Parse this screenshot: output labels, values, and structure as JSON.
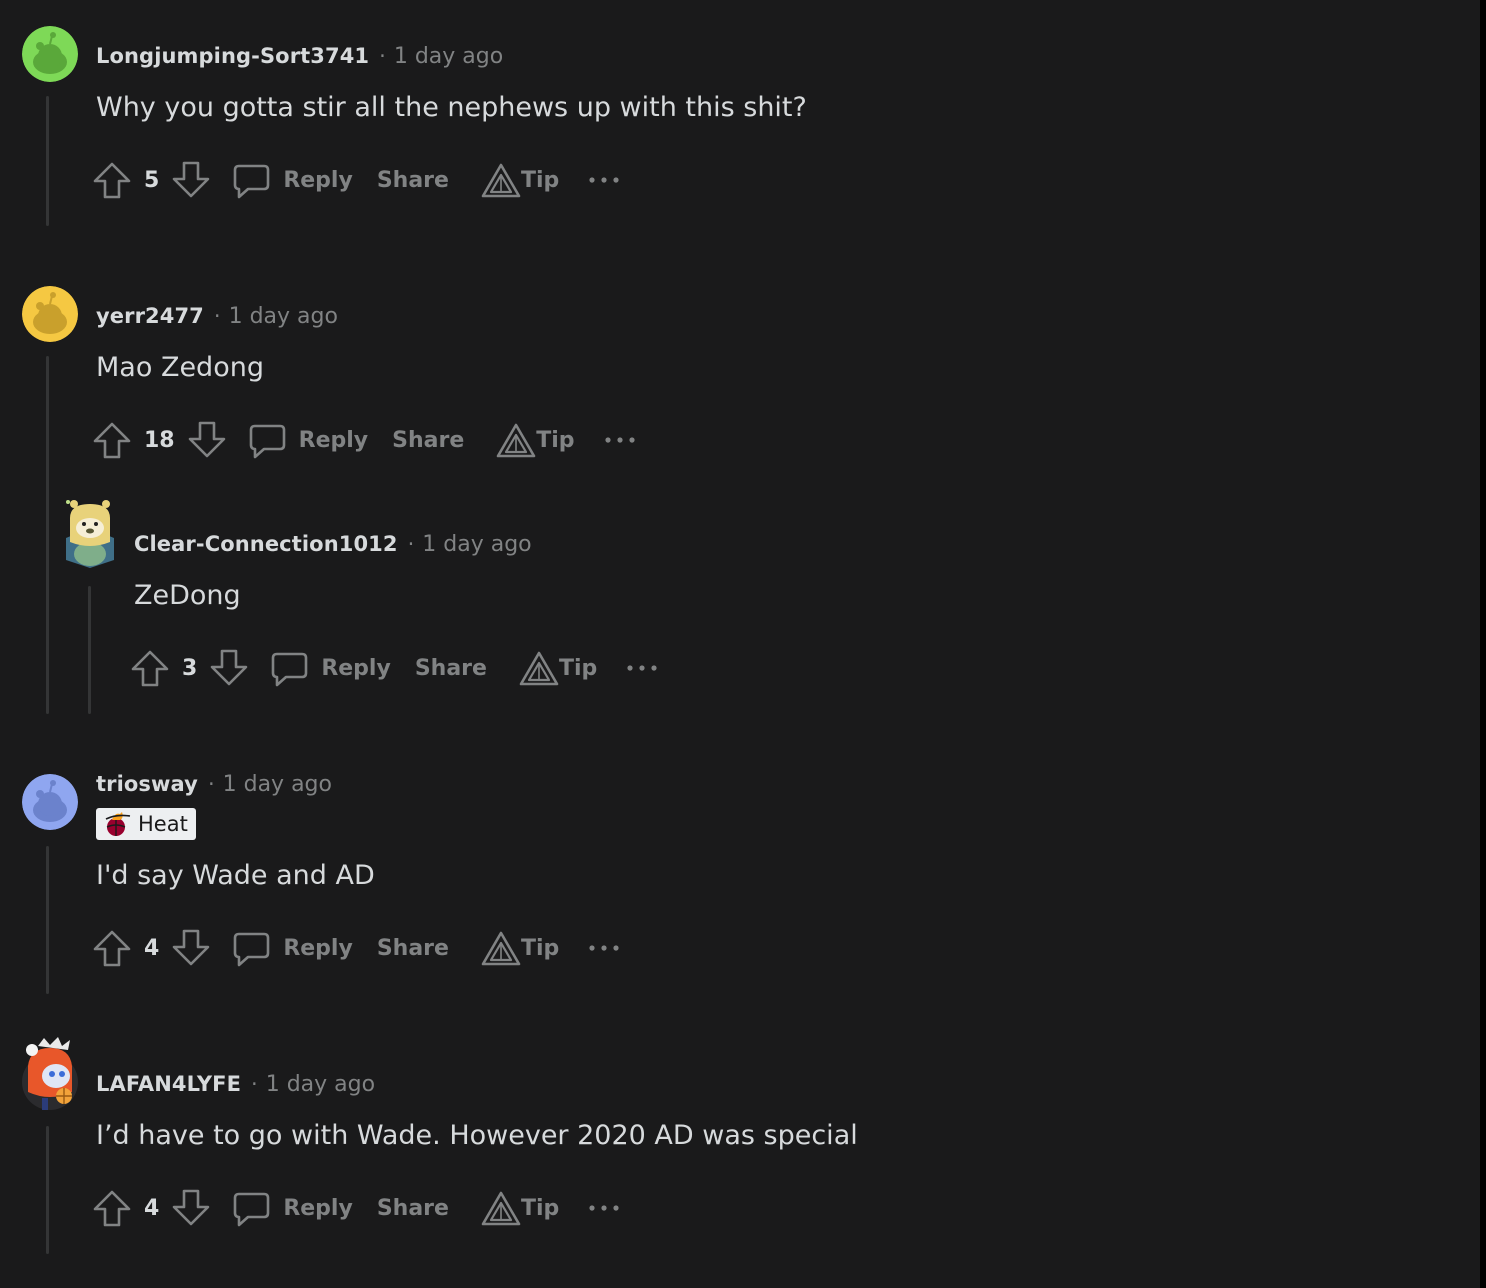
{
  "comments": [
    {
      "username": "Longjumping-Sort3741",
      "separator": "·",
      "time": "1 day ago",
      "body": "Why you gotta stir all the nephews up with this shit?",
      "votes": "5",
      "avatar_color": "#7ed957",
      "actions": {
        "reply": "Reply",
        "share": "Share",
        "tip": "Tip"
      }
    },
    {
      "username": "yerr2477",
      "separator": "·",
      "time": "1 day ago",
      "body": "Mao Zedong",
      "votes": "18",
      "avatar_color": "#f5c842",
      "actions": {
        "reply": "Reply",
        "share": "Share",
        "tip": "Tip"
      }
    },
    {
      "username": "Clear-Connection1012",
      "separator": "·",
      "time": "1 day ago",
      "body": "ZeDong",
      "votes": "3",
      "avatar_color": "#e8d27a",
      "actions": {
        "reply": "Reply",
        "share": "Share",
        "tip": "Tip"
      }
    },
    {
      "username": "triosway",
      "separator": "·",
      "time": "1 day ago",
      "flair": "Heat",
      "body": "I'd say Wade and AD",
      "votes": "4",
      "avatar_color": "#8fa6f0",
      "actions": {
        "reply": "Reply",
        "share": "Share",
        "tip": "Tip"
      }
    },
    {
      "username": "LAFAN4LYFE",
      "separator": "·",
      "time": "1 day ago",
      "body": "I’d have to go with Wade. However 2020 AD was special",
      "votes": "4",
      "avatar_color": "#e8572a",
      "actions": {
        "reply": "Reply",
        "share": "Share",
        "tip": "Tip"
      }
    }
  ],
  "icons": {
    "upvote": "upvote-icon",
    "downvote": "downvote-icon",
    "reply": "comment-bubble-icon",
    "tip": "tip-triangle-icon",
    "more": "more-options-icon"
  },
  "colors": {
    "background": "#1a1a1b",
    "text": "#d7dadc",
    "muted": "#818384",
    "thread_line": "#343536"
  }
}
